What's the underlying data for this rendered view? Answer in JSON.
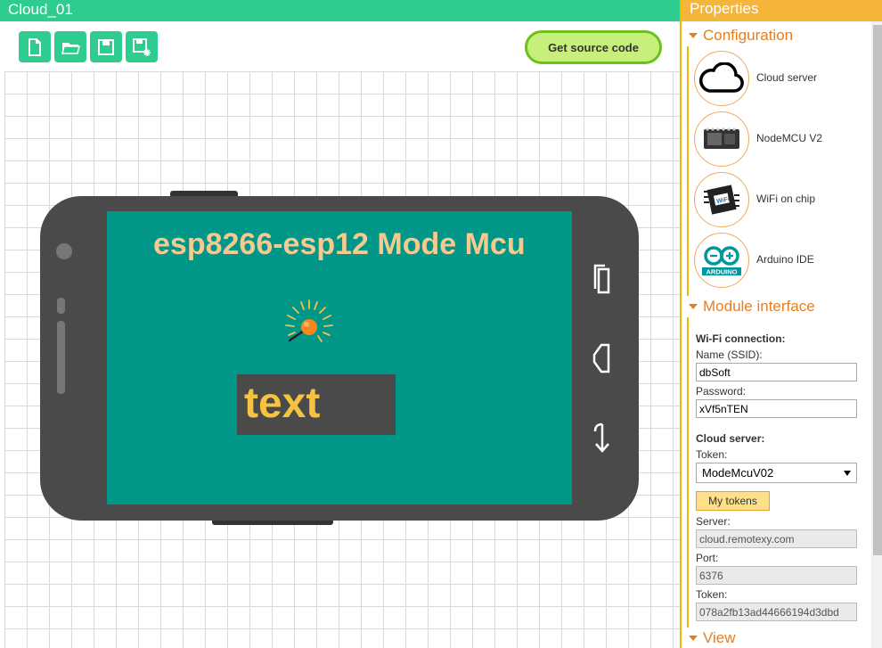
{
  "editor": {
    "title": "Cloud_01",
    "get_source_label": "Get source code",
    "toolbar": [
      {
        "icon": "new-file-icon"
      },
      {
        "icon": "open-folder-icon"
      },
      {
        "icon": "save-icon"
      },
      {
        "icon": "save-as-icon"
      }
    ]
  },
  "phone": {
    "screen_title": "esp8266-esp12 Mode Mcu",
    "text_widget": "text",
    "screen_color": "#009688",
    "title_color": "#f5c98f",
    "text_color": "#f7c23f"
  },
  "panel": {
    "title": "Properties",
    "configuration": {
      "heading": "Configuration",
      "items": [
        {
          "label": "Cloud server",
          "icon": "cloud-icon"
        },
        {
          "label": "NodeMCU V2",
          "icon": "nodemcu-board-icon"
        },
        {
          "label": "WiFi on chip",
          "icon": "wifi-chip-icon"
        },
        {
          "label": "Arduino IDE",
          "icon": "arduino-logo-icon"
        }
      ]
    },
    "module_interface": {
      "heading": "Module interface",
      "wifi_heading": "Wi-Fi connection:",
      "ssid_label": "Name (SSID):",
      "ssid_value": "dbSoft",
      "password_label": "Password:",
      "password_value": "xVf5nTEN",
      "cloud_heading": "Cloud server:",
      "token_select_label": "Token:",
      "token_select_value": "ModeMcuV02",
      "my_tokens_label": "My tokens",
      "server_label": "Server:",
      "server_value": "cloud.remotexy.com",
      "port_label": "Port:",
      "port_value": "6376",
      "token_label": "Token:",
      "token_value": "078a2fb13ad44666194d3dbd"
    },
    "view": {
      "heading": "View"
    }
  },
  "colors": {
    "editor_header": "#2ecc8f",
    "panel_header": "#f5b43a",
    "section_heading": "#e67e22",
    "get_source_bg": "#c7ef7c"
  }
}
